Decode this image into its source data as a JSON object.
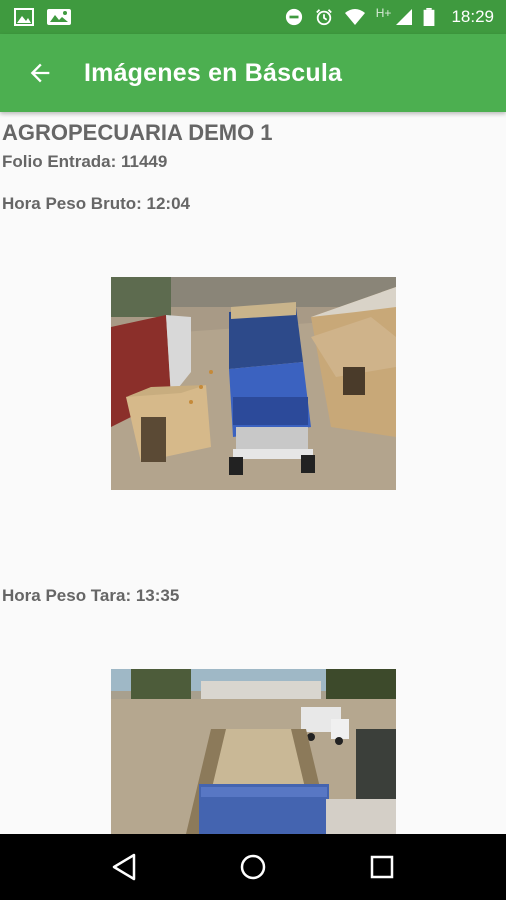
{
  "status_bar": {
    "time": "18:29",
    "network_label": "H+",
    "icons": [
      "image-icon",
      "photo-icon",
      "do-not-disturb-icon",
      "alarm-icon",
      "wifi-icon",
      "signal-icon",
      "battery-icon"
    ]
  },
  "app_bar": {
    "title": "Imágenes en Báscula",
    "back_icon": "arrow-back-icon",
    "color": "#4caf50"
  },
  "content": {
    "company": "AGROPECUARIA DEMO 1",
    "folio": "Folio Entrada: 11449",
    "hora_bruto": "Hora Peso Bruto: 12:04",
    "hora_tara": "Hora Peso Tara: 13:35",
    "photos": [
      "scale-camera-photo-bruto",
      "scale-camera-photo-tara"
    ]
  },
  "nav_bar": {
    "icons": [
      "back-triangle-icon",
      "home-circle-icon",
      "recents-square-icon"
    ]
  }
}
